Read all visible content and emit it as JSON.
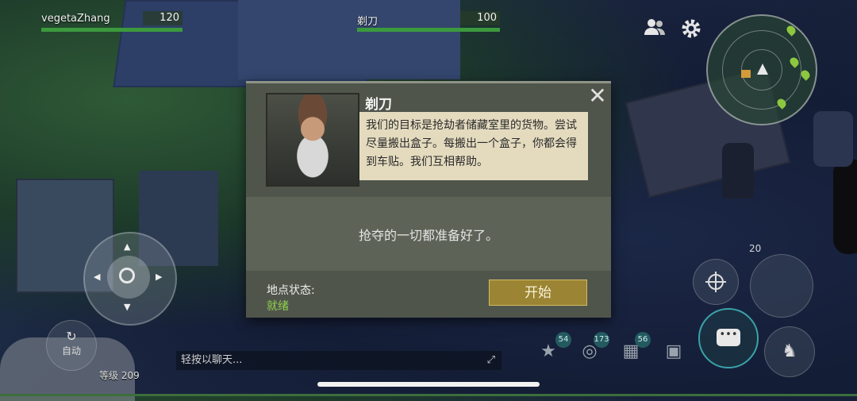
{
  "players": [
    {
      "name": "vegetaZhang",
      "hp": 120,
      "fill": 1.0
    },
    {
      "name": "剃刀",
      "hp": 100,
      "fill": 1.0
    }
  ],
  "icons": {
    "friends": "friends-icon",
    "settings": "gear-icon"
  },
  "dialog": {
    "speaker": "剃刀",
    "message": "我们的目标是抢劫者储藏室里的货物。尝试尽量搬出盒子。每搬出一个盒子，你都会得到车贴。我们互相帮助。",
    "ready_text": "抢夺的一切都准备好了。",
    "status_label": "地点状态:",
    "status_value": "就绪",
    "start_label": "开始",
    "close_symbol": "✕"
  },
  "auto_label": "自动",
  "chat": {
    "placeholder": "轻按以聊天..."
  },
  "level_label": "等级 209",
  "skill_value": "20",
  "inventory_badges": {
    "rank": "54",
    "coins": "173",
    "map": "56"
  },
  "colors": {
    "hp_green": "#3c9a3e",
    "start_button": "#9b8433",
    "status_ready": "#8fd14f",
    "chat_accent": "#3aa2a8"
  }
}
